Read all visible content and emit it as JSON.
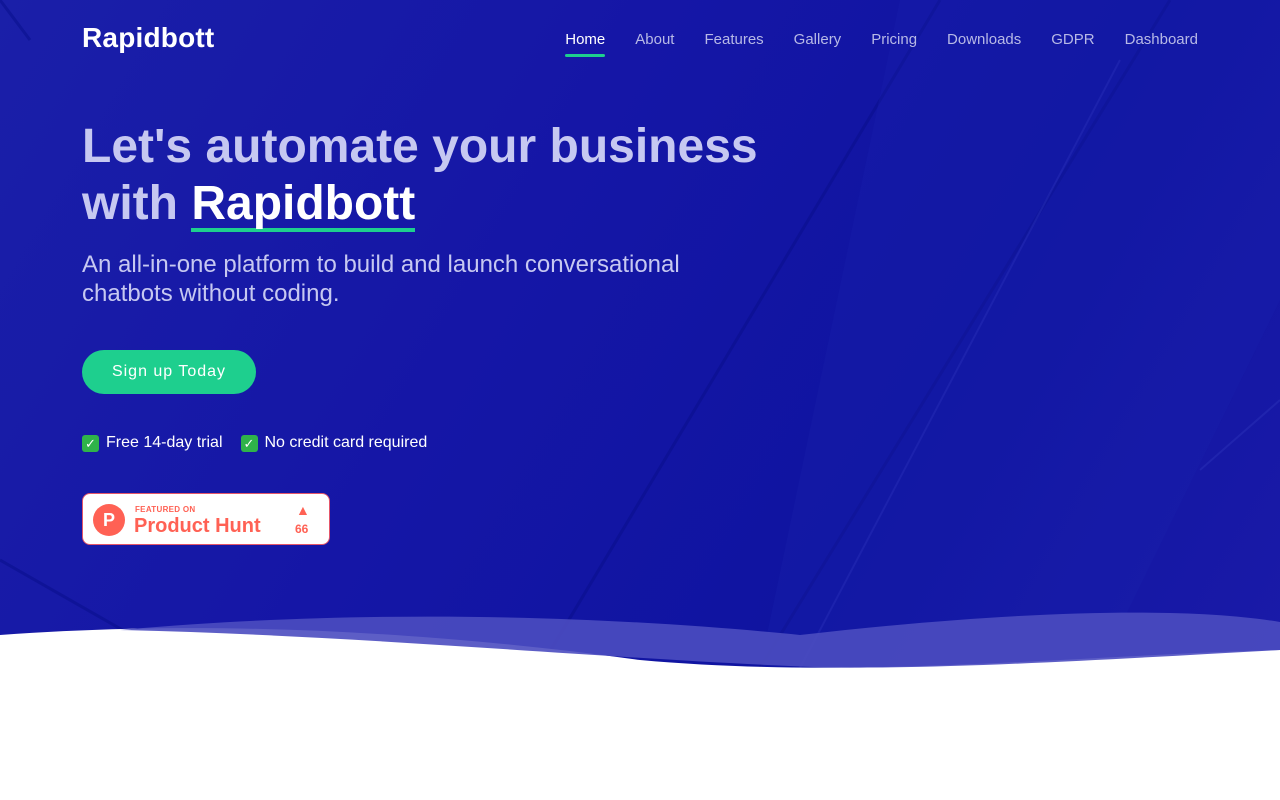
{
  "brand": "Rapidbott",
  "nav": {
    "items": [
      "Home",
      "About",
      "Features",
      "Gallery",
      "Pricing",
      "Downloads",
      "GDPR",
      "Dashboard"
    ],
    "active": "Home"
  },
  "hero": {
    "headline_lead": "Let's automate your business with",
    "headline_brand": "Rapidbott",
    "subhead": "An all-in-one platform to build and launch conversational chatbots without coding.",
    "cta_label": "Sign up Today",
    "perks": [
      "Free 14-day trial",
      "No credit card required"
    ]
  },
  "product_hunt": {
    "featured_label": "FEATURED ON",
    "name": "Product Hunt",
    "logo_letter": "P",
    "upvote_icon": "triangle-up-icon",
    "upvotes": "66"
  },
  "colors": {
    "hero_bg": "#1516a6",
    "accent": "#1ecf8e",
    "product_hunt": "#ff6154"
  }
}
